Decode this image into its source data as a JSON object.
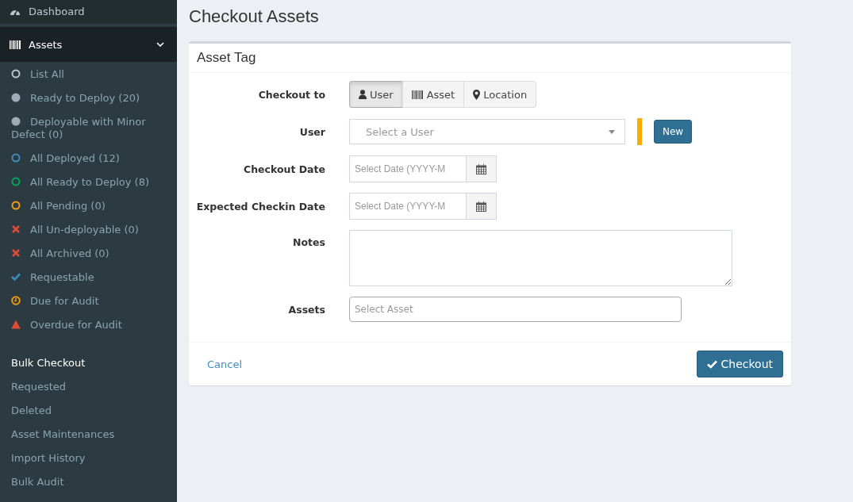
{
  "sidebar": {
    "items": [
      {
        "label": "Dashboard",
        "kind": "dashboard",
        "expanded": false
      },
      {
        "label": "Assets",
        "kind": "barcode",
        "expanded": true
      }
    ],
    "status_items": [
      {
        "label": "List All",
        "kind": "ring",
        "color": "#b8c7ce"
      },
      {
        "label": "Ready to Deploy (20)",
        "kind": "dot",
        "color": "#9eadb5"
      },
      {
        "label": "Deployable with Minor Defect (0)",
        "kind": "dot",
        "color": "#9eadb5"
      },
      {
        "label": "All Deployed (12)",
        "kind": "ring",
        "color": "#3c8dbc"
      },
      {
        "label": "All Ready to Deploy (8)",
        "kind": "ring",
        "color": "#00a65a"
      },
      {
        "label": "All Pending (0)",
        "kind": "ring",
        "color": "#f39c12"
      },
      {
        "label": "All Un-deployable (0)",
        "kind": "x",
        "color": "#dd4b39"
      },
      {
        "label": "All Archived (0)",
        "kind": "x",
        "color": "#dd4b39"
      },
      {
        "label": "Requestable",
        "kind": "check",
        "color": "#3c8dbc"
      },
      {
        "label": "Due for Audit",
        "kind": "clock",
        "color": "#f39c12"
      },
      {
        "label": "Overdue for Audit",
        "kind": "warning",
        "color": "#dd4b39"
      }
    ],
    "links": [
      {
        "label": "Bulk Checkout",
        "selected": true
      },
      {
        "label": "Requested",
        "selected": false
      },
      {
        "label": "Deleted",
        "selected": false
      },
      {
        "label": "Asset Maintenances",
        "selected": false
      },
      {
        "label": "Import History",
        "selected": false
      },
      {
        "label": "Bulk Audit",
        "selected": false
      }
    ]
  },
  "page_title": "Checkout Assets",
  "box": {
    "title": "Asset Tag",
    "checkout_to": {
      "label": "Checkout to",
      "options": [
        {
          "label": "User",
          "kind": "user",
          "selected": true
        },
        {
          "label": "Asset",
          "kind": "barcode",
          "selected": false
        },
        {
          "label": "Location",
          "kind": "pin",
          "selected": false
        }
      ]
    },
    "user": {
      "label": "User",
      "placeholder": "Select a User",
      "required": true,
      "new_button": "New"
    },
    "checkout_date": {
      "label": "Checkout Date",
      "placeholder": "Select Date (YYYY-M"
    },
    "checkin_date": {
      "label": "Expected Checkin Date",
      "placeholder": "Select Date (YYYY-M"
    },
    "notes": {
      "label": "Notes"
    },
    "assets": {
      "label": "Assets",
      "placeholder": "Select Asset"
    },
    "cancel": "Cancel",
    "submit": "Checkout"
  }
}
